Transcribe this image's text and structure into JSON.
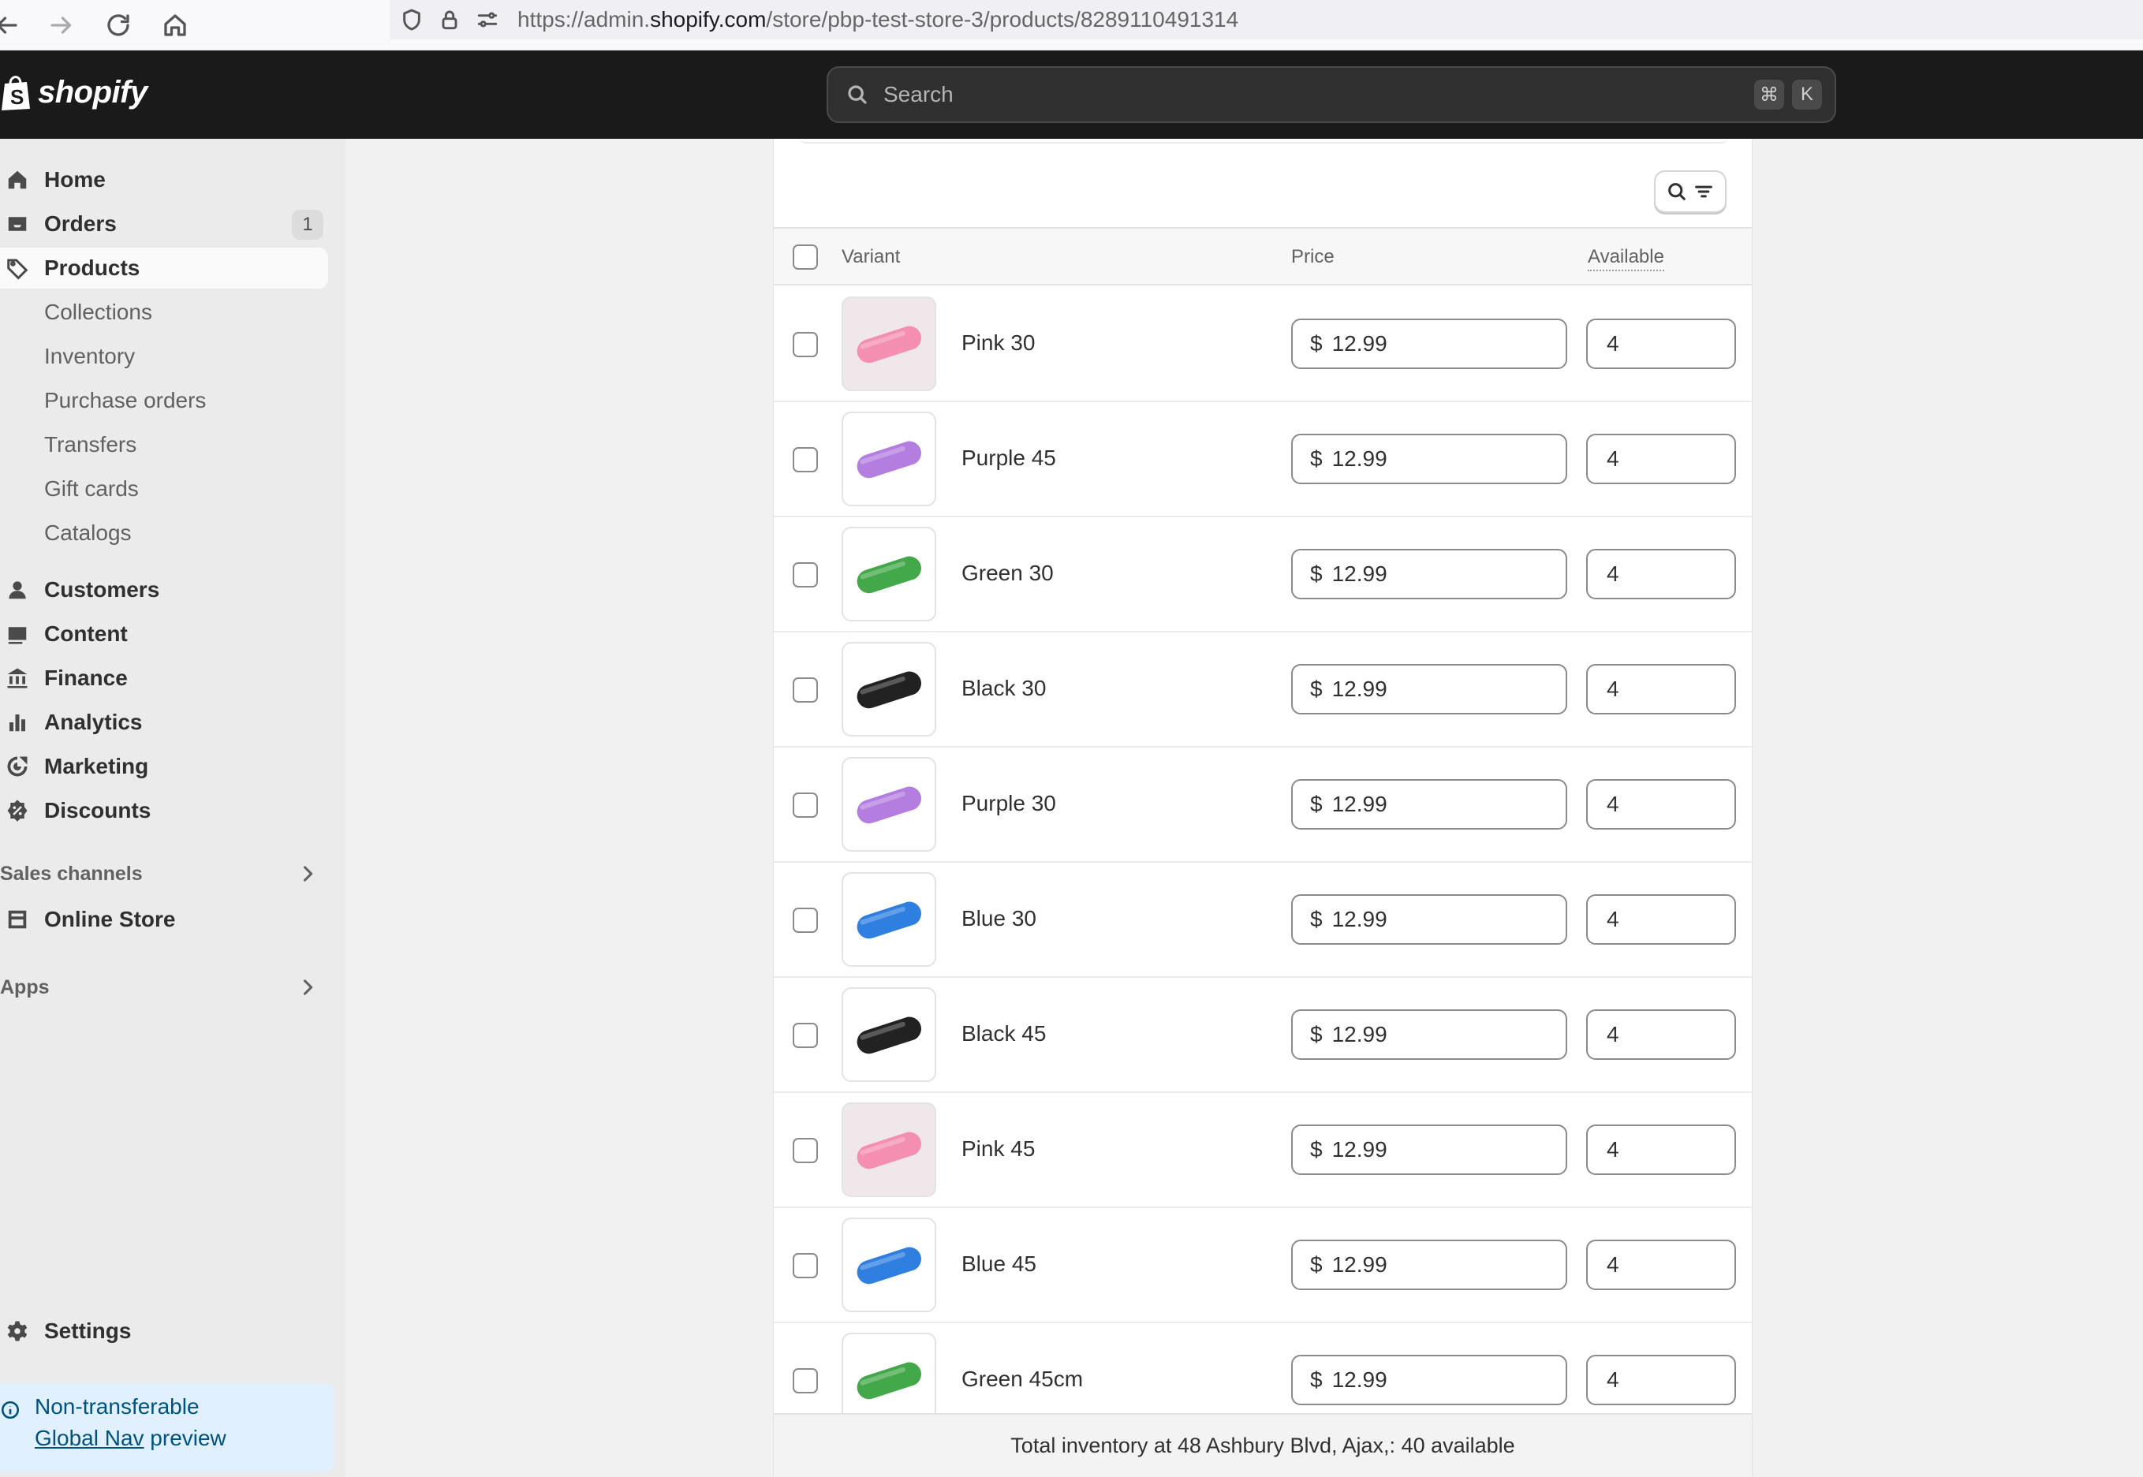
{
  "browser": {
    "url_prefix": "https://admin.",
    "url_domain": "shopify.com",
    "url_path": "/store/pbp-test-store-3/products/8289110491314"
  },
  "topbar": {
    "logo_text": "shopify",
    "search_placeholder": "Search",
    "shortcut_key1": "⌘",
    "shortcut_key2": "K"
  },
  "sidebar": {
    "home": "Home",
    "orders": "Orders",
    "orders_badge": "1",
    "products": "Products",
    "sub": {
      "collections": "Collections",
      "inventory": "Inventory",
      "purchase_orders": "Purchase orders",
      "transfers": "Transfers",
      "gift_cards": "Gift cards",
      "catalogs": "Catalogs"
    },
    "customers": "Customers",
    "content": "Content",
    "finance": "Finance",
    "analytics": "Analytics",
    "marketing": "Marketing",
    "discounts": "Discounts",
    "sales_channels": "Sales channels",
    "online_store": "Online Store",
    "apps": "Apps",
    "settings": "Settings",
    "preview_line1": "Non-transferable",
    "preview_link": "Global Nav",
    "preview_rest": " preview"
  },
  "table": {
    "col_variant": "Variant",
    "col_price": "Price",
    "col_available": "Available",
    "currency": "$",
    "rows": [
      {
        "name": "Pink 30",
        "price": "12.99",
        "available": "4",
        "color": "#f48fb1"
      },
      {
        "name": "Purple 45",
        "price": "12.99",
        "available": "4",
        "color": "#b47ee0"
      },
      {
        "name": "Green 30",
        "price": "12.99",
        "available": "4",
        "color": "#43a84a"
      },
      {
        "name": "Black 30",
        "price": "12.99",
        "available": "4",
        "color": "#222222"
      },
      {
        "name": "Purple 30",
        "price": "12.99",
        "available": "4",
        "color": "#b47ee0"
      },
      {
        "name": "Blue 30",
        "price": "12.99",
        "available": "4",
        "color": "#2f7fe0"
      },
      {
        "name": "Black 45",
        "price": "12.99",
        "available": "4",
        "color": "#222222"
      },
      {
        "name": "Pink 45",
        "price": "12.99",
        "available": "4",
        "color": "#f48fb1"
      },
      {
        "name": "Blue 45",
        "price": "12.99",
        "available": "4",
        "color": "#2f7fe0"
      },
      {
        "name": "Green 45cm",
        "price": "12.99",
        "available": "4",
        "color": "#43a84a"
      }
    ],
    "footer": "Total inventory at 48 Ashbury Blvd, Ajax,: 40 available"
  }
}
